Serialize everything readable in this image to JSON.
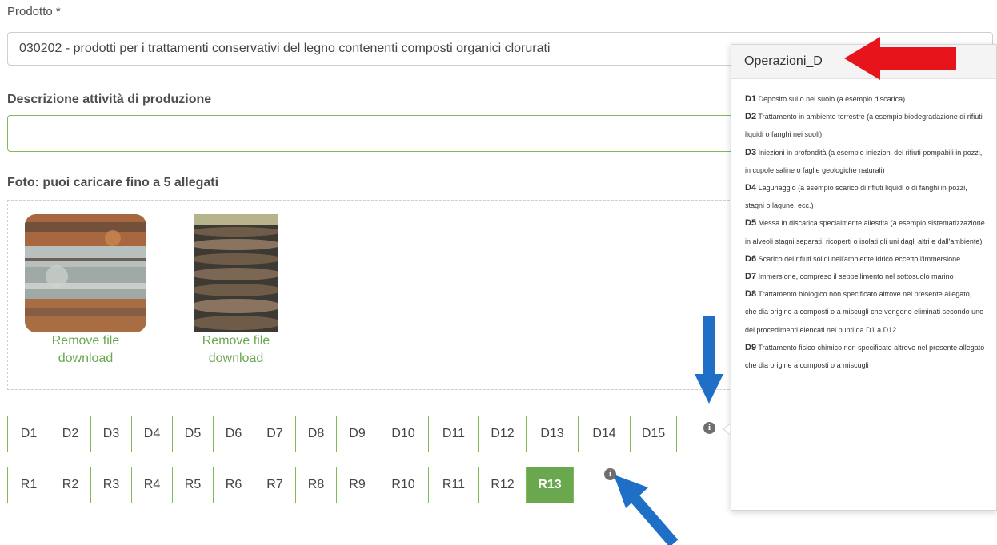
{
  "product": {
    "label": "Prodotto *",
    "value": "030202 - prodotti per i trattamenti conservativi del legno contenenti composti organici clorurati"
  },
  "description": {
    "label": "Descrizione attività di produzione",
    "value": ""
  },
  "photos": {
    "label": "Foto: puoi caricare fino a 5 allegati",
    "items": [
      {
        "remove_label": "Remove file",
        "download_label": "download"
      },
      {
        "remove_label": "Remove file",
        "download_label": "download"
      }
    ]
  },
  "d_codes": [
    "D1",
    "D2",
    "D3",
    "D4",
    "D5",
    "D6",
    "D7",
    "D8",
    "D9",
    "D10",
    "D11",
    "D12",
    "D13",
    "D14",
    "D15"
  ],
  "r_codes": [
    "R1",
    "R2",
    "R3",
    "R4",
    "R5",
    "R6",
    "R7",
    "R8",
    "R9",
    "R10",
    "R11",
    "R12",
    "R13"
  ],
  "selected_code": "R13",
  "info_icon_glyph": "i",
  "popover": {
    "title": "Operazioni_D",
    "entries": [
      {
        "code": "D1",
        "text": "Deposito sul o nel suolo (a esempio discarica)"
      },
      {
        "code": "D2",
        "text": "Trattamento in ambiente terrestre (a esempio biodegradazione di rifiuti liquidi o fanghi nei suoli)"
      },
      {
        "code": "D3",
        "text": "Iniezioni in profondità (a esempio iniezioni dei rifiuti pompabili in pozzi, in cupole saline o faglie geologiche naturali)"
      },
      {
        "code": "D4",
        "text": "Lagunaggio (a esempio scarico di rifiuti liquidi o di fanghi in pozzi, stagni o lagune, ecc.)"
      },
      {
        "code": "D5",
        "text": "Messa in discarica specialmente allestita (a esempio sistematizzazione in alveoli stagni separati, ricoperti o isolati gli uni dagli altri e dall'ambiente)"
      },
      {
        "code": "D6",
        "text": "Scarico dei rifiuti solidi nell'ambiente idrico eccetto l'immersione"
      },
      {
        "code": "D7",
        "text": "Immersione, compreso il seppellimento nel sottosuolo marino"
      },
      {
        "code": "D8",
        "text": "Trattamento biologico non specificato altrove nel presente allegato, che dia origine a composti o a miscugli che vengono eliminati secondo uno dei procedimenti elencati nei punti da D1 a D12"
      },
      {
        "code": "D9",
        "text": "Trattamento fisico-chimico non specificato altrove nel presente allegato che dia origine a composti o a miscugli"
      }
    ]
  },
  "colors": {
    "accent_green": "#6aa84f",
    "arrow_red": "#e8141b",
    "arrow_blue": "#1f6fc7"
  }
}
